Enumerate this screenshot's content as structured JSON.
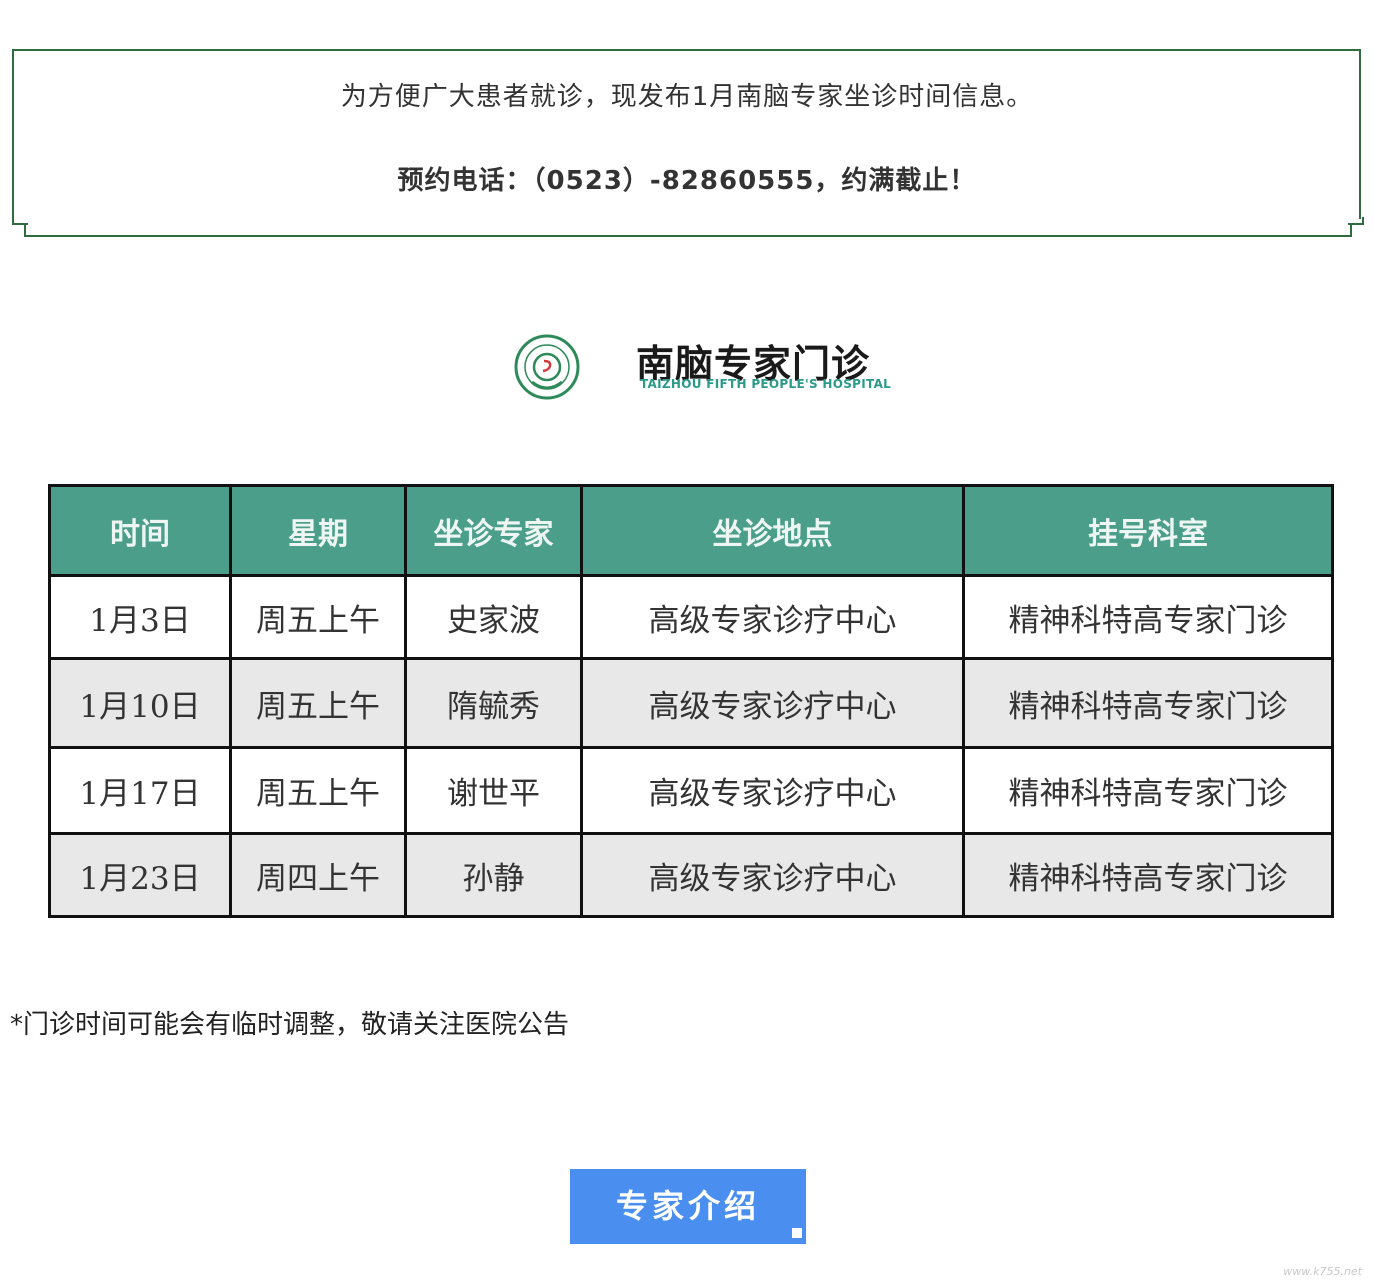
{
  "notice": {
    "line1": "为方便广大患者就诊，现发布1月南脑专家坐诊时间信息。",
    "line2": "预约电话：（0523）-82860555，约满截止！"
  },
  "header": {
    "title": "南脑专家门诊",
    "subtitle": "TAIZHOU FIFTH PEOPLE'S HOSPITAL",
    "logo_icon": "hospital-seal-icon"
  },
  "table": {
    "columns": [
      "时间",
      "星期",
      "坐诊专家",
      "坐诊地点",
      "挂号科室"
    ],
    "rows": [
      [
        "1月3日",
        "周五上午",
        "史家波",
        "高级专家诊疗中心",
        "精神科特高专家门诊"
      ],
      [
        "1月10日",
        "周五上午",
        "隋毓秀",
        "高级专家诊疗中心",
        "精神科特高专家门诊"
      ],
      [
        "1月17日",
        "周五上午",
        "谢世平",
        "高级专家诊疗中心",
        "精神科特高专家门诊"
      ],
      [
        "1月23日",
        "周四上午",
        "孙静",
        "高级专家诊疗中心",
        "精神科特高专家门诊"
      ]
    ]
  },
  "note": "*门诊时间可能会有临时调整，敬请关注医院公告",
  "button": {
    "label": "专家介绍"
  },
  "watermark": "www.k755.net",
  "colors": {
    "accent": "#4a9e8a",
    "border_green": "#2e6b3f",
    "button": "#4a8ef0"
  }
}
